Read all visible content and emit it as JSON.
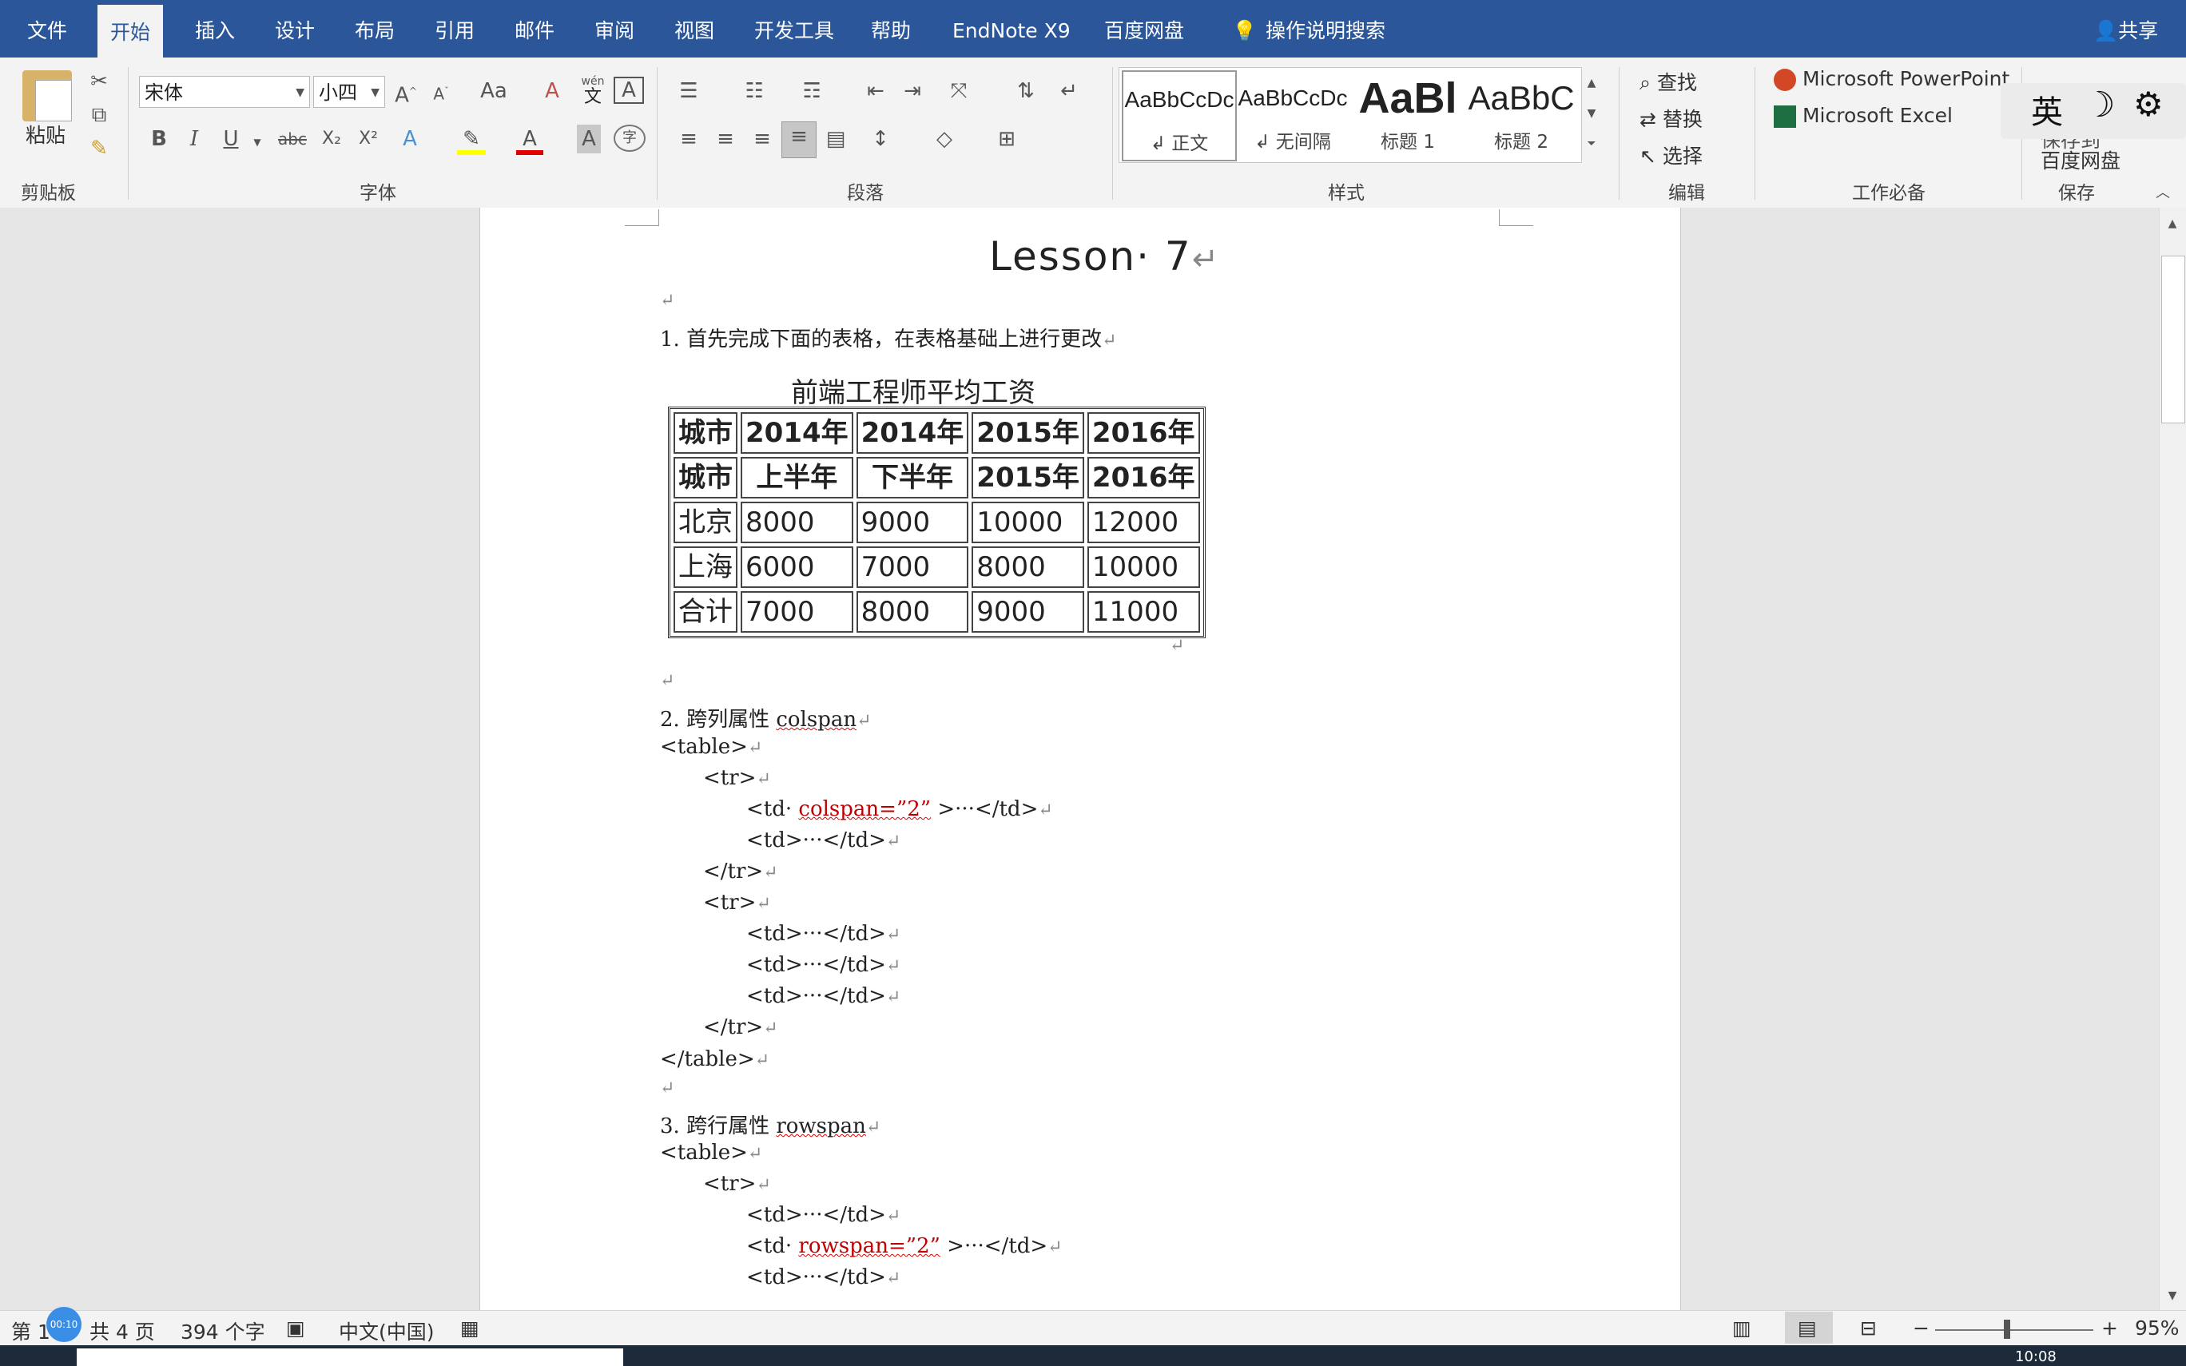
{
  "ribbon_tabs": [
    {
      "label": "文件"
    },
    {
      "label": "开始"
    },
    {
      "label": "插入"
    },
    {
      "label": "设计"
    },
    {
      "label": "布局"
    },
    {
      "label": "引用"
    },
    {
      "label": "邮件"
    },
    {
      "label": "审阅"
    },
    {
      "label": "视图"
    },
    {
      "label": "开发工具"
    },
    {
      "label": "帮助"
    },
    {
      "label": "EndNote X9"
    },
    {
      "label": "百度网盘"
    }
  ],
  "tell_me": "操作说明搜索",
  "share": "共享",
  "clipboard": {
    "paste_label": "粘贴",
    "group": "剪贴板"
  },
  "font": {
    "family": "宋体",
    "size": "小四",
    "group": "字体",
    "aa": "Aa",
    "pinyin_top": "wén",
    "pinyin_char": "文",
    "bold": "B",
    "italic": "I",
    "underline": "U",
    "strike": "abc",
    "sub": "X₂",
    "sup": "X²",
    "char_border": "A",
    "font_color_a": "A",
    "shade_a": "A",
    "circle_char": "字"
  },
  "paragraph": {
    "group": "段落"
  },
  "styles": {
    "group": "样式",
    "items": [
      {
        "preview": "AaBbCcDc",
        "name": "↲ 正文"
      },
      {
        "preview": "AaBbCcDc",
        "name": "↲ 无间隔"
      },
      {
        "preview": "AaBl",
        "name": "标题 1"
      },
      {
        "preview": "AaBbC",
        "name": "标题 2"
      }
    ]
  },
  "editing": {
    "group": "编辑",
    "find": "查找",
    "replace": "替换",
    "select": "选择"
  },
  "addins": {
    "group": "工作必备",
    "powerpoint": "Microsoft PowerPoint",
    "excel": "Microsoft Excel"
  },
  "save_group": {
    "group": "保存",
    "label_top": "保存到",
    "label_bottom": "百度网盘"
  },
  "ime": {
    "lang": "英",
    "moon": "☽",
    "gear": "⚙"
  },
  "document": {
    "title": "Lesson· 7",
    "p1": "1. 首先完成下面的表格，在表格基础上进行更改",
    "table_caption": "前端工程师平均工资",
    "table_rows": [
      [
        "城市",
        "2014年",
        "2014年",
        "2015年",
        "2016年"
      ],
      [
        "城市",
        "上半年",
        "下半年",
        "2015年",
        "2016年"
      ],
      [
        "北京",
        "8000",
        "9000",
        "10000",
        "12000"
      ],
      [
        "上海",
        "6000",
        "7000",
        "8000",
        "10000"
      ],
      [
        "合计",
        "7000",
        "8000",
        "9000",
        "11000"
      ]
    ],
    "s2_num": "2. 跨列属性 ",
    "s2_kw": "colspan",
    "s3_num": "3. 跨行属性 ",
    "s3_kw": "rowspan",
    "code_table_open": "<table>",
    "code_table_close": "</table>",
    "code_tr_open": "<tr>",
    "code_tr_close": "</tr>",
    "code_td": "<td>···</td>",
    "code_td_attr_start": "<td· ",
    "colspan_attr": "colspan=”2”",
    "rowspan_attr": "rowspan=”2”",
    "code_td_attr_end": " >···</td>",
    "para_mark": "↵"
  },
  "status": {
    "page": "第 1",
    "total": "共 4 页",
    "words": "394 个字",
    "lang": "中文(中国)",
    "zoom": "95%",
    "timer": "00:10"
  },
  "taskbar": {
    "clock": "10:08"
  }
}
